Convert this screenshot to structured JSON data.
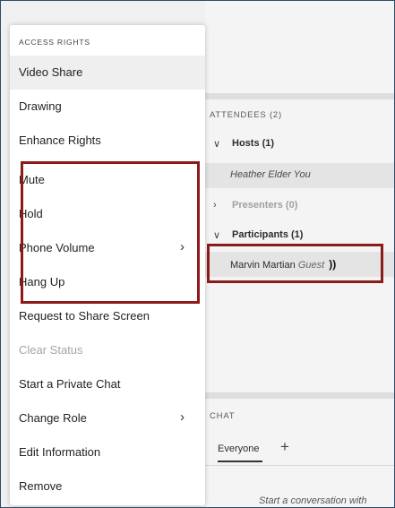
{
  "context_menu": {
    "header": "ACCESS RIGHTS",
    "items": [
      {
        "label": "Video Share",
        "state": "hover"
      },
      {
        "label": "Drawing"
      },
      {
        "label": "Enhance Rights"
      },
      {
        "label": "Mute"
      },
      {
        "label": "Hold"
      },
      {
        "label": "Phone Volume",
        "submenu": true
      },
      {
        "label": "Hang Up"
      },
      {
        "label": "Request to Share Screen"
      },
      {
        "label": "Clear Status",
        "disabled": true
      },
      {
        "label": "Start a Private Chat"
      },
      {
        "label": "Change Role",
        "submenu": true
      },
      {
        "label": "Edit Information"
      },
      {
        "label": "Remove"
      }
    ]
  },
  "attendees": {
    "header": "ATTENDEES (2)",
    "hosts": {
      "label": "Hosts (1)",
      "members": [
        {
          "name": "Heather Elder",
          "tag": "You"
        }
      ]
    },
    "presenters": {
      "label": "Presenters (0)"
    },
    "participants": {
      "label": "Participants (1)",
      "members": [
        {
          "name": "Marvin Martian",
          "tag": "Guest",
          "icon": "speaker-icon",
          "glyph": "))"
        }
      ]
    }
  },
  "chat": {
    "header": "CHAT",
    "tab": "Everyone",
    "add_glyph": "+",
    "empty_text": "Start a conversation with"
  },
  "icons": {
    "chevron_down": "∨",
    "chevron_right": "›"
  },
  "colors": {
    "highlight_box": "#8b1a1a",
    "frame_border": "#2e4d6b"
  }
}
